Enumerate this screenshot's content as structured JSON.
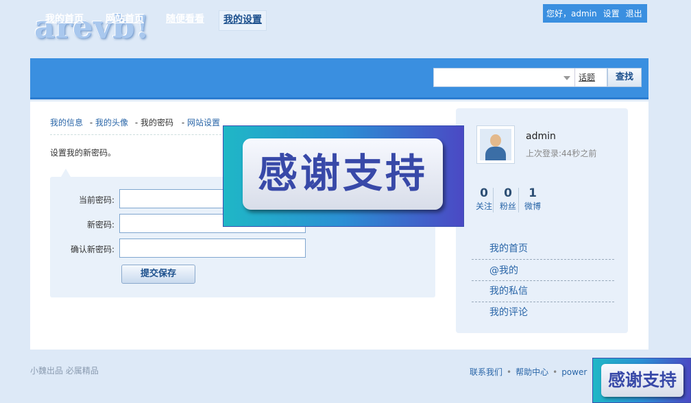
{
  "logo": "arevb!",
  "userbar": {
    "greeting": "您好，admin",
    "settings": "设置",
    "logout": "退出"
  },
  "nav": [
    {
      "label": "我的首页"
    },
    {
      "label": "网站首页"
    },
    {
      "label": "随便看看"
    },
    {
      "label": "我的设置",
      "active": true
    }
  ],
  "search": {
    "value": "",
    "topic": "话题",
    "button": "查找"
  },
  "tabs": {
    "info": "我的信息",
    "avatar": "我的头像",
    "password": "我的密码",
    "site": "网站设置",
    "sep": "-"
  },
  "hint": "设置我的新密码。",
  "form": {
    "current_label": "当前密码:",
    "new_label": "新密码:",
    "confirm_label": "确认新密码:",
    "submit": "提交保存"
  },
  "profile": {
    "name": "admin",
    "last_login": "上次登录:44秒之前",
    "stats": [
      {
        "num": "0",
        "label": "关注"
      },
      {
        "num": "0",
        "label": "粉丝"
      },
      {
        "num": "1",
        "label": "微博"
      }
    ],
    "links": [
      "我的首页",
      "@我的",
      "我的私信",
      "我的评论"
    ]
  },
  "footer": {
    "left": "小魏出品  必属精品",
    "contact": "联系我们",
    "help": "帮助中心",
    "powered": "power"
  },
  "overlay": {
    "text": "感谢支持"
  },
  "colors": {
    "accent": "#3a8fe0",
    "link": "#2a66a8",
    "banner_text": "#3849a8"
  }
}
